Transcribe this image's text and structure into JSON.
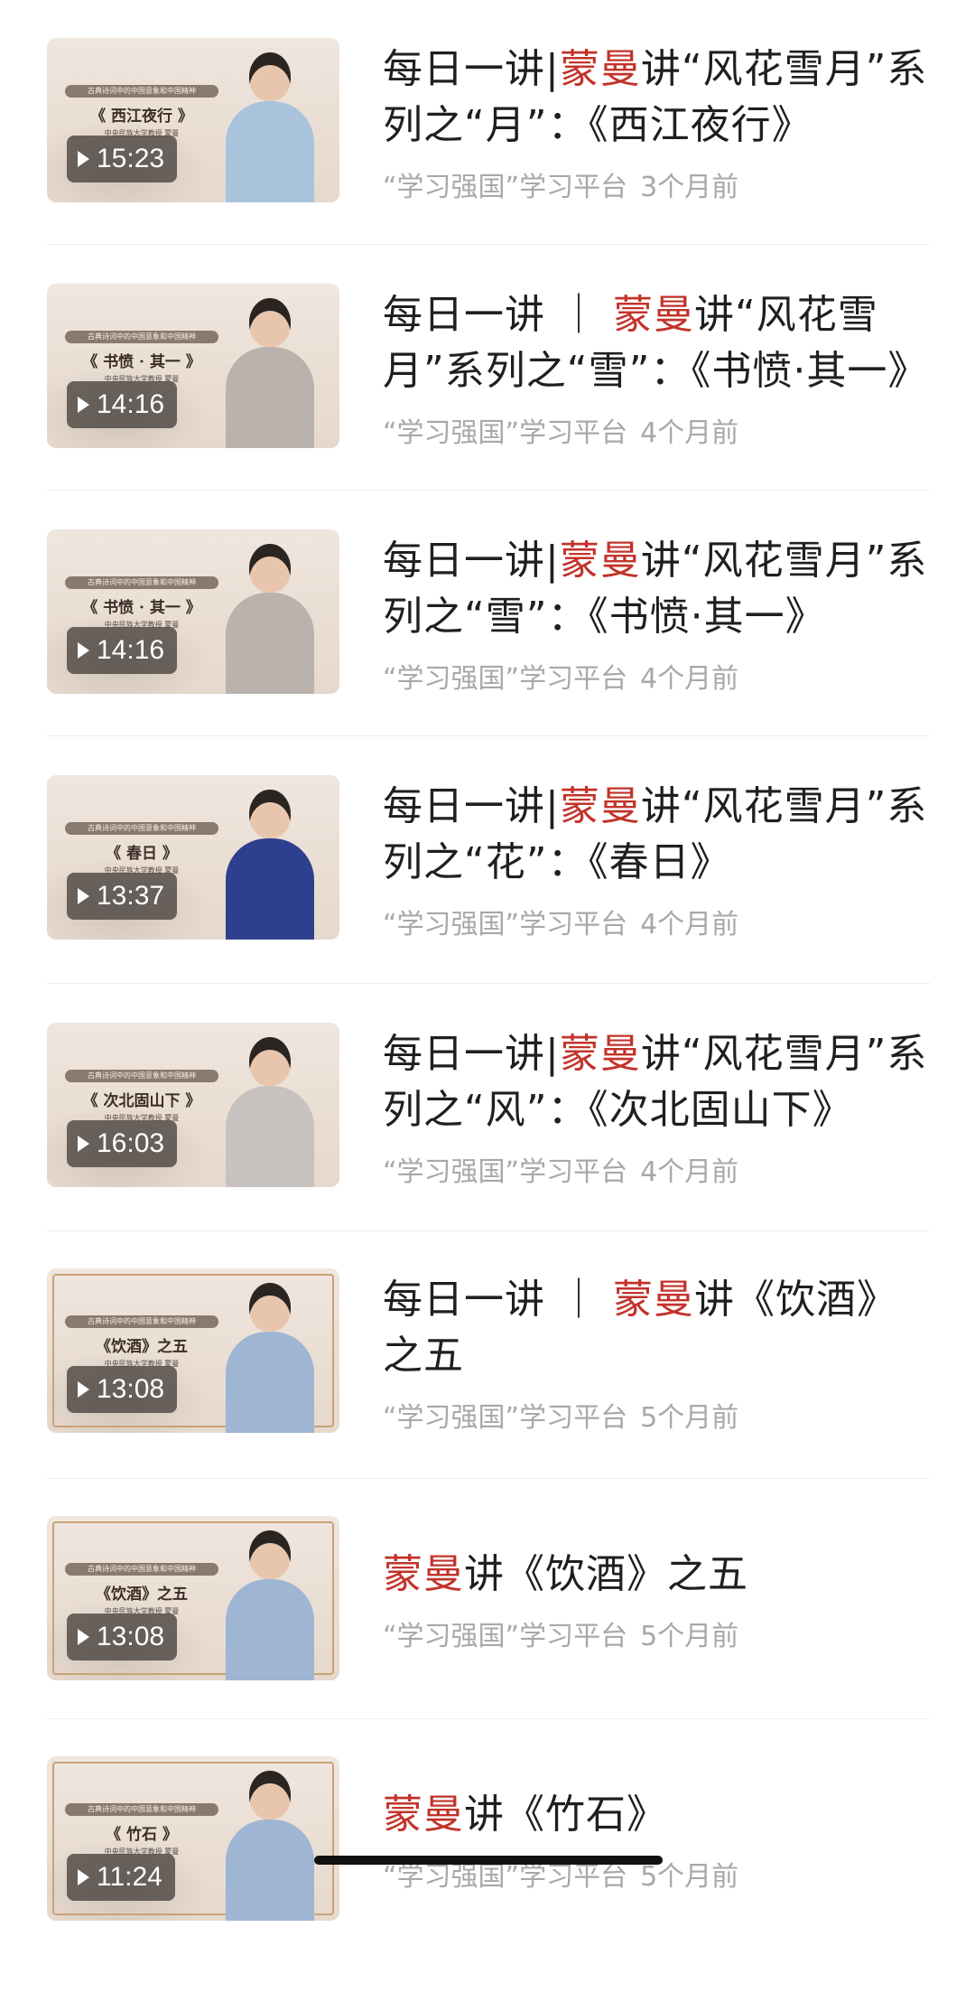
{
  "videos": [
    {
      "title_prefix": "每日一讲|",
      "title_highlight": "蒙曼",
      "title_suffix": "讲“风花雪月”系列之“月”：《西江夜行》",
      "source": "“学习强国”学习平台",
      "date": "3个月前",
      "duration": "15:23",
      "thumb_banner": "古典诗词中的中国意象和中国精神",
      "thumb_poem": "《 西江夜行 》",
      "thumb_credit": "中央民族大学教授  蒙曼",
      "outfit_color": "#a9c3dc",
      "framed": false
    },
    {
      "title_prefix": "每日一讲 ｜ ",
      "title_highlight": "蒙曼",
      "title_suffix": "讲“风花雪月”系列之“雪”：《书愤·其一》",
      "source": "“学习强国”学习平台",
      "date": "4个月前",
      "duration": "14:16",
      "thumb_banner": "古典诗词中的中国意象和中国精神",
      "thumb_poem": "《 书愤 · 其一 》",
      "thumb_credit": "中央民族大学教授  蒙曼",
      "outfit_color": "#b9b2ad",
      "framed": false
    },
    {
      "title_prefix": "每日一讲|",
      "title_highlight": "蒙曼",
      "title_suffix": "讲“风花雪月”系列之“雪”：《书愤·其一》",
      "source": "“学习强国”学习平台",
      "date": "4个月前",
      "duration": "14:16",
      "thumb_banner": "古典诗词中的中国意象和中国精神",
      "thumb_poem": "《 书愤 · 其一 》",
      "thumb_credit": "中央民族大学教授  蒙曼",
      "outfit_color": "#b9b2ad",
      "framed": false
    },
    {
      "title_prefix": "每日一讲|",
      "title_highlight": "蒙曼",
      "title_suffix": "讲“风花雪月”系列之“花”：《春日》",
      "source": "“学习强国”学习平台",
      "date": "4个月前",
      "duration": "13:37",
      "thumb_banner": "古典诗词中的中国意象和中国精神",
      "thumb_poem": "《 春日 》",
      "thumb_credit": "中央民族大学教授  蒙曼",
      "outfit_color": "#2f3f8f",
      "framed": false
    },
    {
      "title_prefix": "每日一讲|",
      "title_highlight": "蒙曼",
      "title_suffix": "讲“风花雪月”系列之“风”：《次北固山下》",
      "source": "“学习强国”学习平台",
      "date": "4个月前",
      "duration": "16:03",
      "thumb_banner": "古典诗词中的中国意象和中国精神",
      "thumb_poem": "《 次北固山下 》",
      "thumb_credit": "中央民族大学教授  蒙曼",
      "outfit_color": "#c7c2bf",
      "framed": false
    },
    {
      "title_prefix": "每日一讲 ｜ ",
      "title_highlight": "蒙曼",
      "title_suffix": "讲《饮酒》之五",
      "source": "“学习强国”学习平台",
      "date": "5个月前",
      "duration": "13:08",
      "thumb_banner": "古典诗词中的中国意象和中国精神",
      "thumb_poem": "《饮酒》之五",
      "thumb_credit": "中央民族大学教授  蒙曼",
      "outfit_color": "#9eb5d3",
      "framed": true
    },
    {
      "title_prefix": "",
      "title_highlight": "蒙曼",
      "title_suffix": "讲《饮酒》之五",
      "source": "“学习强国”学习平台",
      "date": "5个月前",
      "duration": "13:08",
      "thumb_banner": "古典诗词中的中国意象和中国精神",
      "thumb_poem": "《饮酒》之五",
      "thumb_credit": "中央民族大学教授  蒙曼",
      "outfit_color": "#9eb5d3",
      "framed": true
    },
    {
      "title_prefix": "",
      "title_highlight": "蒙曼",
      "title_suffix": "讲《竹石》",
      "source": "“学习强国”学习平台",
      "date": "5个月前",
      "duration": "11:24",
      "thumb_banner": "古典诗词中的中国意象和中国精神",
      "thumb_poem": "《 竹石 》",
      "thumb_credit": "中央民族大学教授  蒙曼",
      "outfit_color": "#9eb5d3",
      "framed": true
    }
  ]
}
